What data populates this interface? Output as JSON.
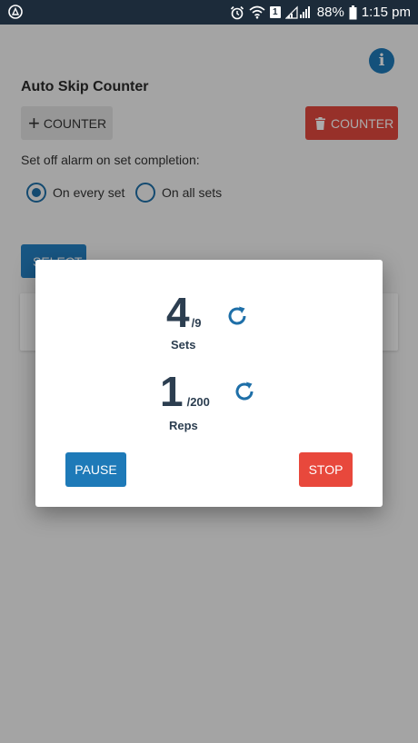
{
  "status_bar": {
    "battery": "88%",
    "time": "1:15 pm",
    "sim_badge": "1",
    "icons": [
      "app-notification-icon",
      "alarm-icon",
      "wifi-icon",
      "signal-icon",
      "battery-icon"
    ]
  },
  "app": {
    "title": "Auto Skip Counter",
    "add_counter_label": "COUNTER",
    "delete_counter_label": "COUNTER",
    "alarm_label": "Set off alarm on set completion:",
    "radio_options": [
      {
        "label": "On every set",
        "checked": true
      },
      {
        "label": "On all sets",
        "checked": false
      }
    ],
    "select_label": "SELECT"
  },
  "dialog": {
    "sets": {
      "current": "4",
      "total": "/9",
      "label": "Sets"
    },
    "reps": {
      "current": "1",
      "total": "/200",
      "label": "Reps"
    },
    "pause_label": "PAUSE",
    "stop_label": "STOP"
  },
  "colors": {
    "status_bar": "#1c2b3a",
    "primary_blue": "#1e7ab8",
    "danger_red": "#e8483c",
    "text_dark": "#2c3e50"
  }
}
